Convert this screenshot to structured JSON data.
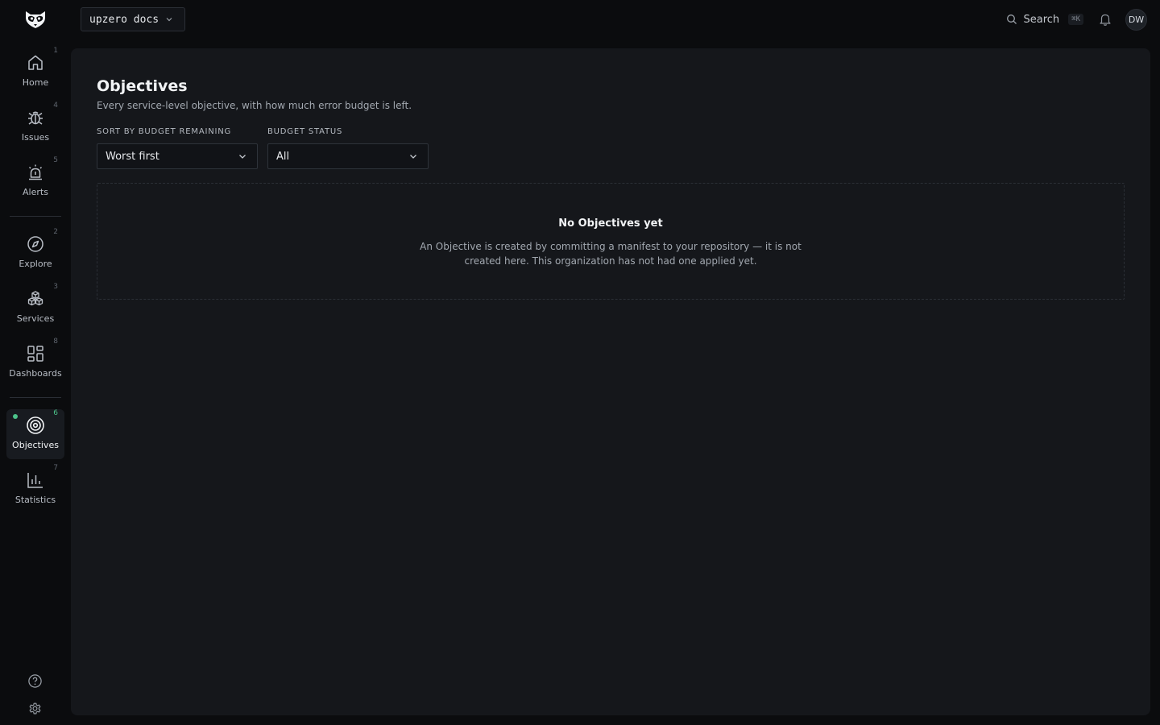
{
  "topbar": {
    "org_name": "upzero docs",
    "search_label": "Search",
    "search_shortcut": "⌘K",
    "avatar_initials": "DW"
  },
  "sidebar": {
    "items": [
      {
        "label": "Home",
        "key": "1",
        "icon": "home-icon"
      },
      {
        "label": "Issues",
        "key": "4",
        "icon": "bug-icon"
      },
      {
        "label": "Alerts",
        "key": "5",
        "icon": "siren-icon"
      },
      {
        "label": "Explore",
        "key": "2",
        "icon": "compass-icon"
      },
      {
        "label": "Services",
        "key": "3",
        "icon": "cubes-icon"
      },
      {
        "label": "Dashboards",
        "key": "8",
        "icon": "grid-icon"
      },
      {
        "label": "Objectives",
        "key": "6",
        "icon": "target-icon",
        "active": true
      },
      {
        "label": "Statistics",
        "key": "7",
        "icon": "bar-chart-icon"
      }
    ],
    "footer_icons": [
      "help-icon",
      "settings-icon"
    ]
  },
  "page": {
    "title": "Objectives",
    "subtitle": "Every service-level objective, with how much error budget is left.",
    "filters": {
      "sort": {
        "label": "SORT BY BUDGET REMAINING",
        "value": "Worst first"
      },
      "status": {
        "label": "BUDGET STATUS",
        "value": "All"
      }
    },
    "empty_state": {
      "title": "No Objectives yet",
      "text": "An Objective is created by committing a manifest to your repository — it is not created here. This organization has not had one applied yet."
    }
  },
  "colors": {
    "background": "#0b0c0e",
    "panel": "#15171b",
    "accent": "#4cc38a"
  }
}
